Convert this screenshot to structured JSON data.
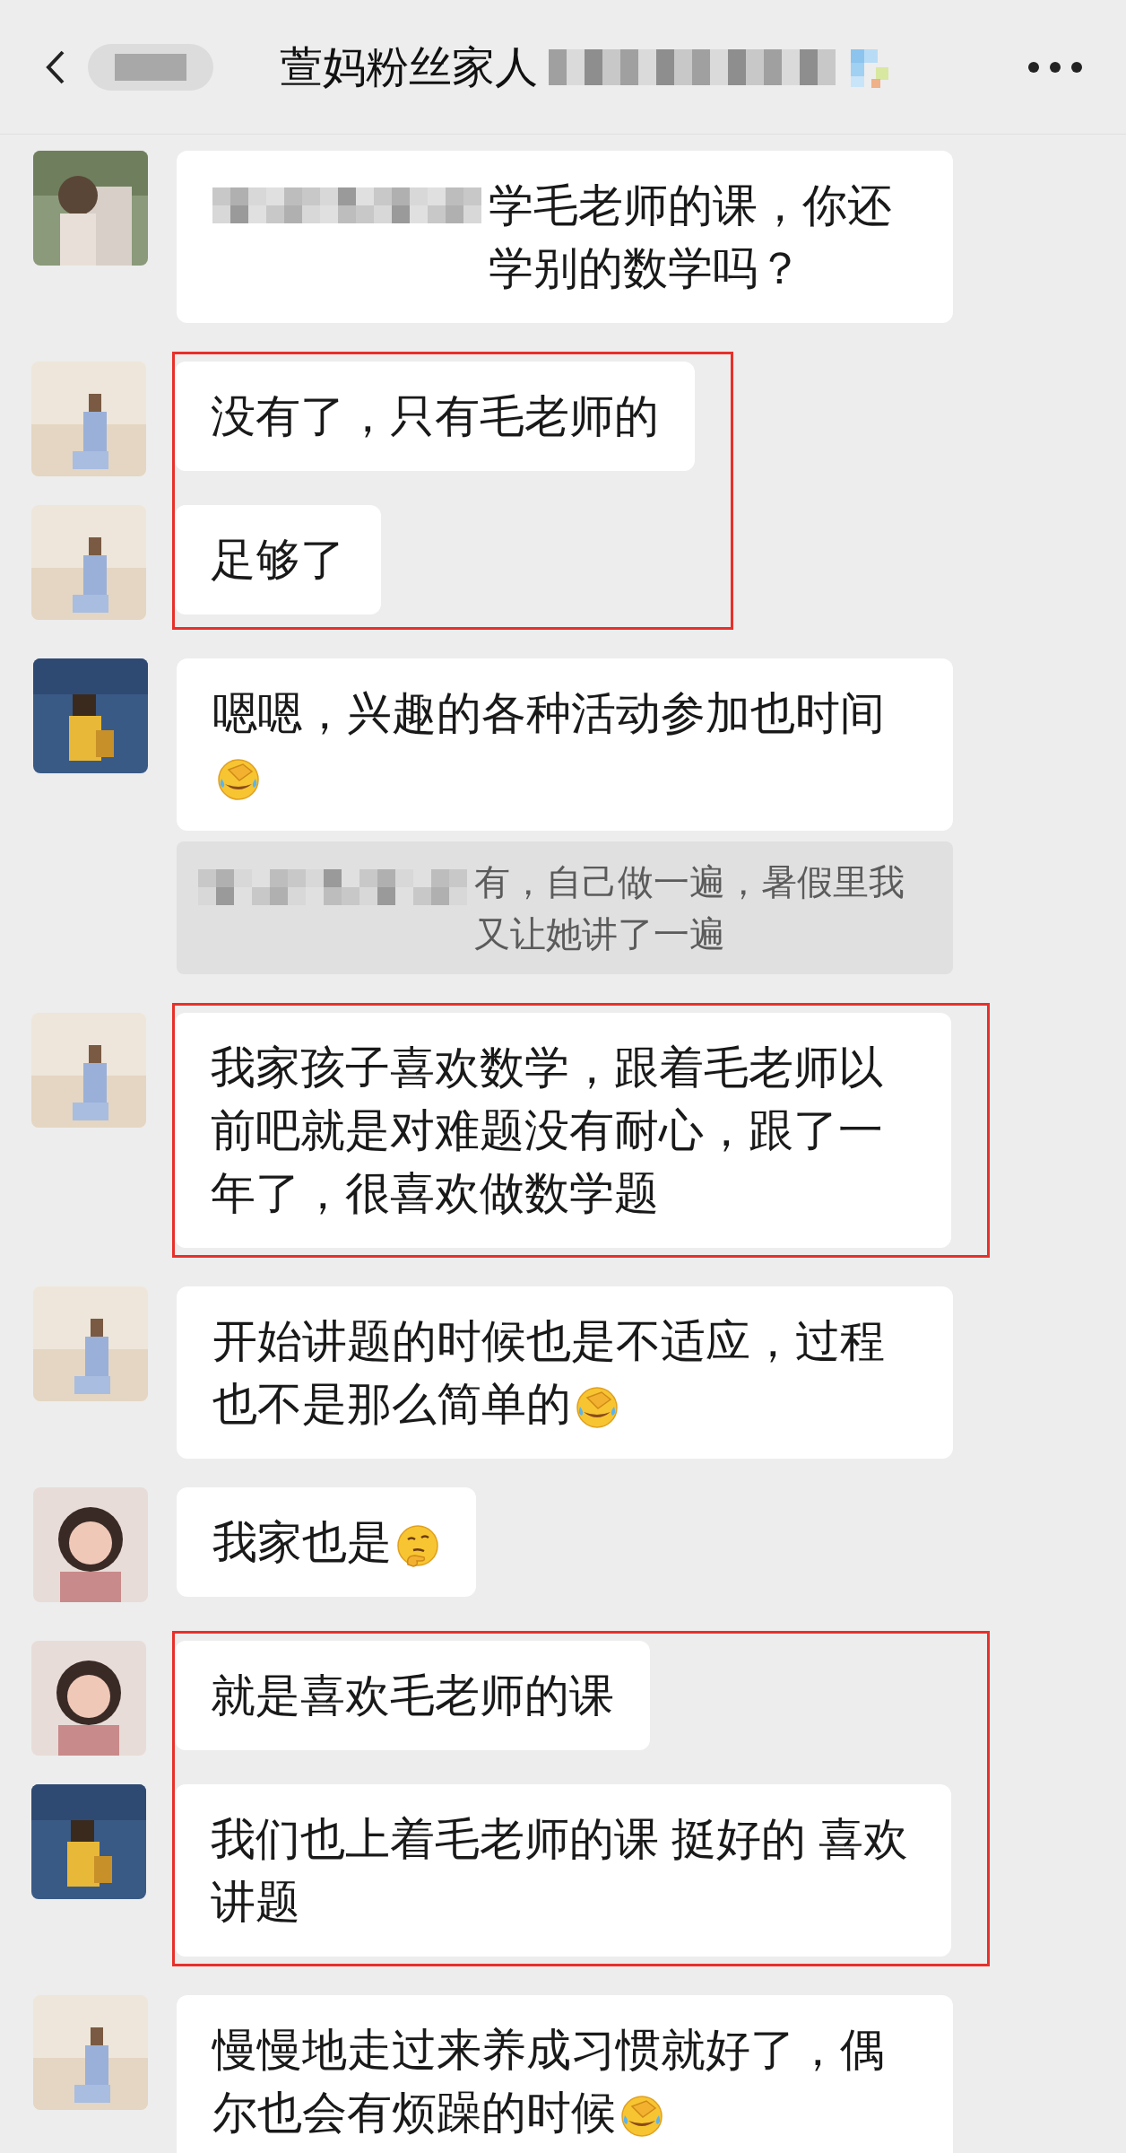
{
  "header": {
    "title": "萱妈粉丝家人"
  },
  "items": [
    {
      "highlighted": false,
      "messages": [
        {
          "kind": "text",
          "mention_hidden": true,
          "text": "学毛老师的课，你还学别的数学吗？"
        }
      ]
    },
    {
      "highlighted": true,
      "messages": [
        {
          "kind": "text",
          "text": "没有了，只有毛老师的"
        },
        {
          "kind": "text",
          "text": "足够了"
        }
      ]
    },
    {
      "highlighted": false,
      "messages": [
        {
          "kind": "facepalm",
          "text": "嗯嗯，兴趣的各种活动参加也时间",
          "quote": {
            "sender_hidden": true,
            "text": "有，自己做一遍，暑假里我又让她讲了一遍"
          }
        }
      ]
    },
    {
      "highlighted": true,
      "messages": [
        {
          "kind": "text",
          "text": "我家孩子喜欢数学，跟着毛老师以前吧就是对难题没有耐心，跟了一年了，很喜欢做数学题"
        }
      ]
    },
    {
      "highlighted": false,
      "messages": [
        {
          "kind": "facepalm",
          "text": "开始讲题的时候也是不适应，过程也不是那么简单的"
        }
      ]
    },
    {
      "highlighted": false,
      "messages": [
        {
          "kind": "thinking",
          "text": "我家也是"
        }
      ]
    },
    {
      "highlighted": true,
      "messages": [
        {
          "kind": "text",
          "text": "就是喜欢毛老师的课"
        },
        {
          "kind": "text",
          "text": "我们也上着毛老师的课 挺好的 喜欢讲题"
        }
      ]
    },
    {
      "highlighted": false,
      "messages": [
        {
          "kind": "facepalm",
          "text": "慢慢地走过来养成习惯就好了，偶尔也会有烦躁的时候"
        }
      ]
    }
  ]
}
